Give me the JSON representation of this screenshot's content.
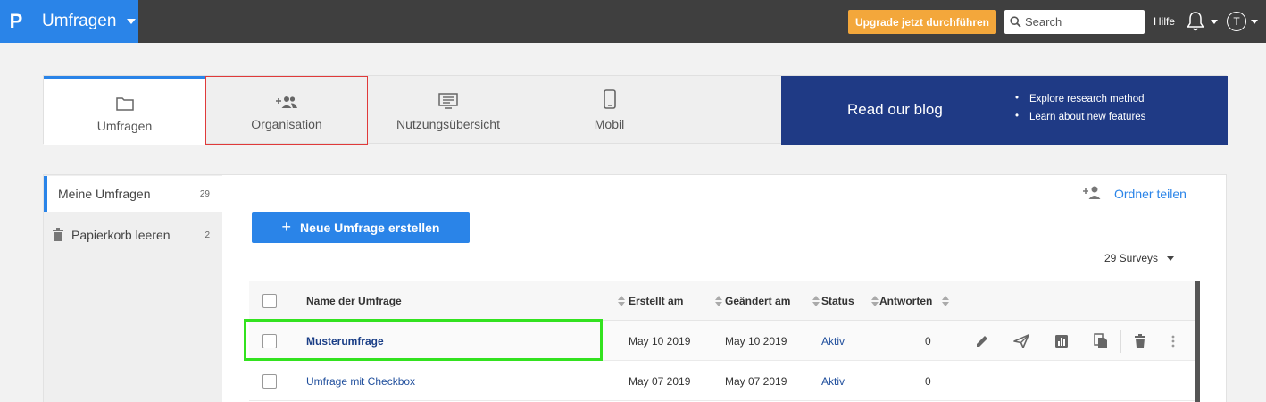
{
  "topbar": {
    "brand_title": "Umfragen",
    "brand_logo": "P",
    "upgrade_label": "Upgrade jetzt durchführen",
    "search_placeholder": "Search",
    "help_label": "Hilfe",
    "avatar_initial": "T",
    "brand_color": "#2a84e8",
    "upgrade_color": "#f3a73b"
  },
  "nav": {
    "tabs": [
      {
        "label": "Umfragen",
        "icon": "folder-icon",
        "active": true
      },
      {
        "label": "Organisation",
        "icon": "group-add-icon",
        "active": false
      },
      {
        "label": "Nutzungsübersicht",
        "icon": "monitor-list-icon",
        "active": false
      },
      {
        "label": "Mobil",
        "icon": "mobile-icon",
        "active": false
      }
    ],
    "blog": {
      "title": "Read our blog",
      "items": [
        "Explore research method",
        "Learn about new features"
      ],
      "color": "#1f3a85"
    }
  },
  "sidebar": {
    "items": [
      {
        "label": "Meine Umfragen",
        "count": "29"
      },
      {
        "label": "Papierkorb leeren",
        "count": "2"
      }
    ]
  },
  "main": {
    "share_folder_label": "Ordner teilen",
    "new_survey_label": "Neue Umfrage erstellen",
    "surveys_count_label": "29 Surveys"
  },
  "table": {
    "headers": [
      "Name der Umfrage",
      "Erstellt am",
      "Geändert am",
      "Status",
      "Antworten"
    ],
    "rows": [
      {
        "name": "Musterumfrage",
        "created": "May 10 2019",
        "modified": "May 10 2019",
        "status": "Aktiv",
        "responses": "0"
      },
      {
        "name": "Umfrage mit Checkbox",
        "created": "May 07 2019",
        "modified": "May 07 2019",
        "status": "Aktiv",
        "responses": "0"
      }
    ],
    "row_actions": [
      "edit-icon",
      "send-icon",
      "analytics-icon",
      "copy-icon",
      "delete-icon",
      "more-vert-icon"
    ]
  }
}
